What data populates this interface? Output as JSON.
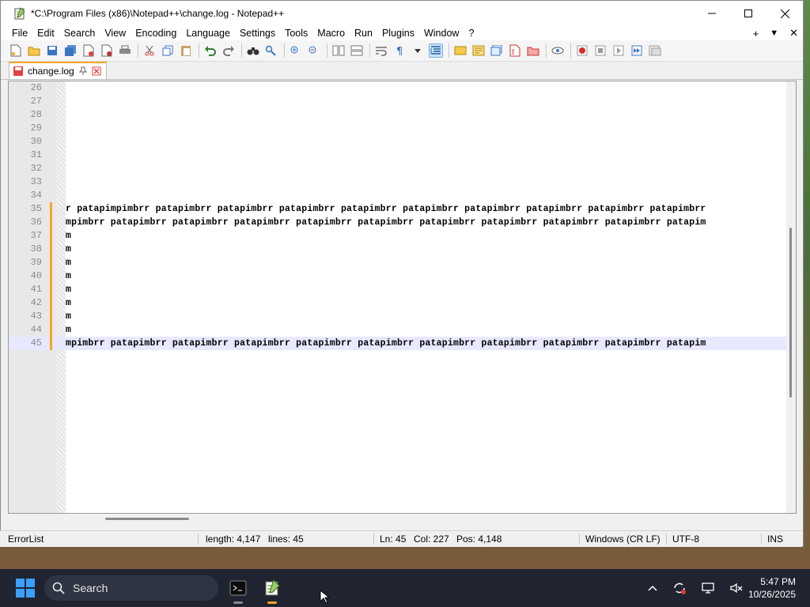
{
  "window": {
    "title": "*C:\\Program Files (x86)\\Notepad++\\change.log - Notepad++",
    "controls": {
      "minimize": "—",
      "maximize": "☐",
      "close": "✕"
    }
  },
  "menu": {
    "items": [
      "File",
      "Edit",
      "Search",
      "View",
      "Encoding",
      "Language",
      "Settings",
      "Tools",
      "Macro",
      "Run",
      "Plugins",
      "Window",
      "?"
    ],
    "right": {
      "add": "+",
      "dropdown": "▼",
      "close": "✕"
    }
  },
  "tab": {
    "label": "change.log",
    "pin": "📌",
    "close": "✕"
  },
  "editor": {
    "lines": [
      {
        "num": "26",
        "text": "",
        "changed": false,
        "current": false
      },
      {
        "num": "27",
        "text": "",
        "changed": false,
        "current": false
      },
      {
        "num": "28",
        "text": "",
        "changed": false,
        "current": false
      },
      {
        "num": "29",
        "text": "",
        "changed": false,
        "current": false
      },
      {
        "num": "30",
        "text": "",
        "changed": false,
        "current": false
      },
      {
        "num": "31",
        "text": "",
        "changed": false,
        "current": false
      },
      {
        "num": "32",
        "text": "",
        "changed": false,
        "current": false
      },
      {
        "num": "33",
        "text": "",
        "changed": false,
        "current": false
      },
      {
        "num": "34",
        "text": "",
        "changed": false,
        "current": false
      },
      {
        "num": "35",
        "text": "r patapimpimbrr patapimbrr patapimbrr patapimbrr patapimbrr patapimbrr patapimbrr patapimbrr patapimbrr patapimbrr",
        "changed": true,
        "current": false
      },
      {
        "num": "36",
        "text": "mpimbrr patapimbrr patapimbrr patapimbrr patapimbrr patapimbrr patapimbrr patapimbrr patapimbrr patapimbrr patapim",
        "changed": true,
        "current": false
      },
      {
        "num": "37",
        "text": "m",
        "changed": true,
        "current": false
      },
      {
        "num": "38",
        "text": "m",
        "changed": true,
        "current": false
      },
      {
        "num": "39",
        "text": "m",
        "changed": true,
        "current": false
      },
      {
        "num": "40",
        "text": "m",
        "changed": true,
        "current": false
      },
      {
        "num": "41",
        "text": "m",
        "changed": true,
        "current": false
      },
      {
        "num": "42",
        "text": "m",
        "changed": true,
        "current": false
      },
      {
        "num": "43",
        "text": "m",
        "changed": true,
        "current": false
      },
      {
        "num": "44",
        "text": "m",
        "changed": true,
        "current": false
      },
      {
        "num": "45",
        "text": "mpimbrr patapimbrr patapimbrr patapimbrr patapimbrr patapimbrr patapimbrr patapimbrr patapimbrr patapimbrr patapim",
        "changed": true,
        "current": true
      }
    ]
  },
  "status": {
    "panel": "ErrorList",
    "length": "length: 4,147",
    "lines": "lines: 45",
    "ln": "Ln: 45",
    "col": "Col: 227",
    "pos": "Pos: 4,148",
    "eol": "Windows (CR LF)",
    "encoding": "UTF-8",
    "mode": "INS"
  },
  "taskbar": {
    "search_label": "Search",
    "time": "5:47 PM",
    "date": "10/26/2025"
  },
  "colors": {
    "accent": "#f5a623",
    "current_line": "#e8e8ff",
    "taskbar": "#1f2430"
  }
}
